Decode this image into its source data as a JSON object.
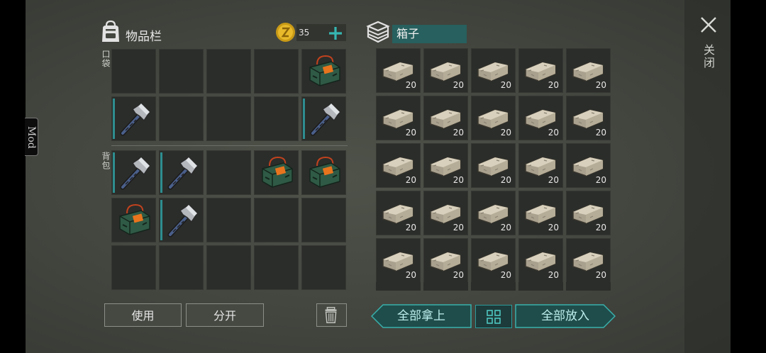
{
  "app": {
    "mod_tab": "Mod",
    "close_label": "关闭"
  },
  "inventory": {
    "title": "物品栏",
    "coins": "35",
    "section_pocket": "口袋",
    "section_backpack": "背包",
    "pocket_slots": [
      {
        "item": "",
        "qty": ""
      },
      {
        "item": "",
        "qty": ""
      },
      {
        "item": "",
        "qty": ""
      },
      {
        "item": "",
        "qty": ""
      },
      {
        "item": "supply-bag",
        "qty": ""
      },
      {
        "item": "pickaxe",
        "qty": ""
      },
      {
        "item": "",
        "qty": ""
      },
      {
        "item": "",
        "qty": ""
      },
      {
        "item": "",
        "qty": ""
      },
      {
        "item": "pickaxe",
        "qty": ""
      }
    ],
    "backpack_slots": [
      {
        "item": "pickaxe",
        "qty": ""
      },
      {
        "item": "pickaxe",
        "qty": ""
      },
      {
        "item": "",
        "qty": ""
      },
      {
        "item": "supply-bag",
        "qty": ""
      },
      {
        "item": "supply-bag",
        "qty": ""
      },
      {
        "item": "supply-bag",
        "qty": ""
      },
      {
        "item": "pickaxe",
        "qty": ""
      },
      {
        "item": "",
        "qty": ""
      },
      {
        "item": "",
        "qty": ""
      },
      {
        "item": "",
        "qty": ""
      },
      {
        "item": "",
        "qty": ""
      },
      {
        "item": "",
        "qty": ""
      },
      {
        "item": "",
        "qty": ""
      },
      {
        "item": "",
        "qty": ""
      },
      {
        "item": "",
        "qty": ""
      }
    ],
    "use_button": "使用",
    "split_button": "分开"
  },
  "box": {
    "title": "箱子",
    "slots": [
      {
        "item": "stone",
        "qty": "20"
      },
      {
        "item": "stone",
        "qty": "20"
      },
      {
        "item": "stone",
        "qty": "20"
      },
      {
        "item": "stone",
        "qty": "20"
      },
      {
        "item": "stone",
        "qty": "20"
      },
      {
        "item": "stone",
        "qty": "20"
      },
      {
        "item": "stone",
        "qty": "20"
      },
      {
        "item": "stone",
        "qty": "20"
      },
      {
        "item": "stone",
        "qty": "20"
      },
      {
        "item": "stone",
        "qty": "20"
      },
      {
        "item": "stone",
        "qty": "20"
      },
      {
        "item": "stone",
        "qty": "20"
      },
      {
        "item": "stone",
        "qty": "20"
      },
      {
        "item": "stone",
        "qty": "20"
      },
      {
        "item": "stone",
        "qty": "20"
      },
      {
        "item": "stone",
        "qty": "20"
      },
      {
        "item": "stone",
        "qty": "20"
      },
      {
        "item": "stone",
        "qty": "20"
      },
      {
        "item": "stone",
        "qty": "20"
      },
      {
        "item": "stone",
        "qty": "20"
      },
      {
        "item": "stone",
        "qty": "20"
      },
      {
        "item": "stone",
        "qty": "20"
      },
      {
        "item": "stone",
        "qty": "20"
      },
      {
        "item": "stone",
        "qty": "20"
      },
      {
        "item": "stone",
        "qty": "20"
      }
    ],
    "take_all_button": "全部拿上",
    "put_all_button": "全部放入"
  },
  "colors": {
    "accent": "#2e9c9c",
    "slot": "#2b2d2a",
    "background": "#44473f"
  }
}
